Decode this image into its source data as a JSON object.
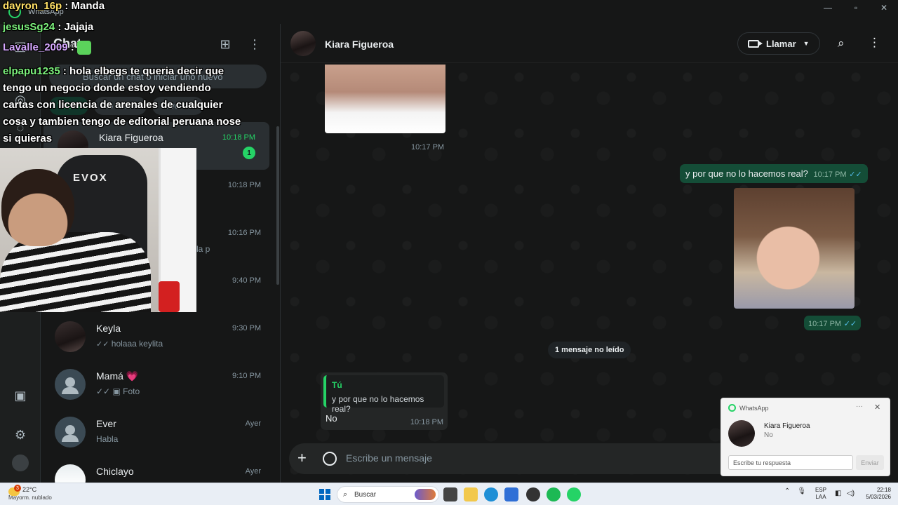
{
  "window": {
    "app_title": "WhatsApp"
  },
  "sidebar": {
    "title": "Chats",
    "search_placeholder": "Buscar un chat o iniciar uno nuevo",
    "filters": [
      "Todos",
      "No leídos",
      "Favoritos"
    ],
    "chats": [
      {
        "name": "Kiara Figueroa",
        "time": "10:18 PM",
        "preview": "",
        "unread": "1"
      },
      {
        "name": "",
        "time": "10:18 PM",
        "preview": ""
      },
      {
        "name": "",
        "time": "10:16 PM",
        "preview": "la p"
      },
      {
        "name": "",
        "time": "9:40 PM",
        "preview": ""
      },
      {
        "name": "Keyla",
        "time": "9:30 PM",
        "preview": "holaaa keylita"
      },
      {
        "name": "Mamá 💗",
        "time": "9:10 PM",
        "preview": "Foto"
      },
      {
        "name": "Ever",
        "time": "Ayer",
        "preview": "Habla"
      },
      {
        "name": "Chiclayo",
        "time": "Ayer",
        "preview": ""
      }
    ]
  },
  "conversation": {
    "contact_name": "Kiara Figueroa",
    "call_label": "Llamar",
    "messages": {
      "image_in_time": "10:17 PM",
      "out_text": "y por que no lo hacemos real?",
      "out_text_time": "10:17 PM",
      "out_image_time": "10:17 PM",
      "unread_divider": "1 mensaje no leído",
      "reply_quote_author": "Tú",
      "reply_quote_text": "y por que no lo hacemos real?",
      "reply_text": "No",
      "reply_time": "10:18 PM"
    },
    "composer_placeholder": "Escribe un mensaje"
  },
  "notification": {
    "app": "WhatsApp",
    "from": "Kiara Figueroa",
    "body": "No",
    "reply_placeholder": "Escribe tu respuesta",
    "send_label": "Enviar"
  },
  "stream_overlay": {
    "lines": [
      {
        "user": "dayron_16p",
        "text": ": Manda"
      },
      {
        "user": "jesusSg24",
        "text": ": Jajaja"
      },
      {
        "user": "Lavalle_2009",
        "text": ":"
      }
    ],
    "long_message_user": "elpapu1235",
    "long_message_text": ": hola elbegs te queria decir que tengo un negocio donde estoy vendiendo cartas con licencia de arenales de cualquier cosa y tambien tengo de editorial peruana nose si quieras",
    "webcam_chair_brand": "EVOX"
  },
  "taskbar": {
    "weather_temp": "22°C",
    "weather_condition": "Mayorm. nublado",
    "weather_badge": "3",
    "search_label": "Buscar",
    "lang_top": "ESP",
    "lang_bottom": "LAA",
    "time": "22:18",
    "date": "5/03/2026"
  },
  "colors": {
    "accent_green": "#25d366",
    "outgoing_bubble": "#144d37",
    "background": "#161717"
  }
}
